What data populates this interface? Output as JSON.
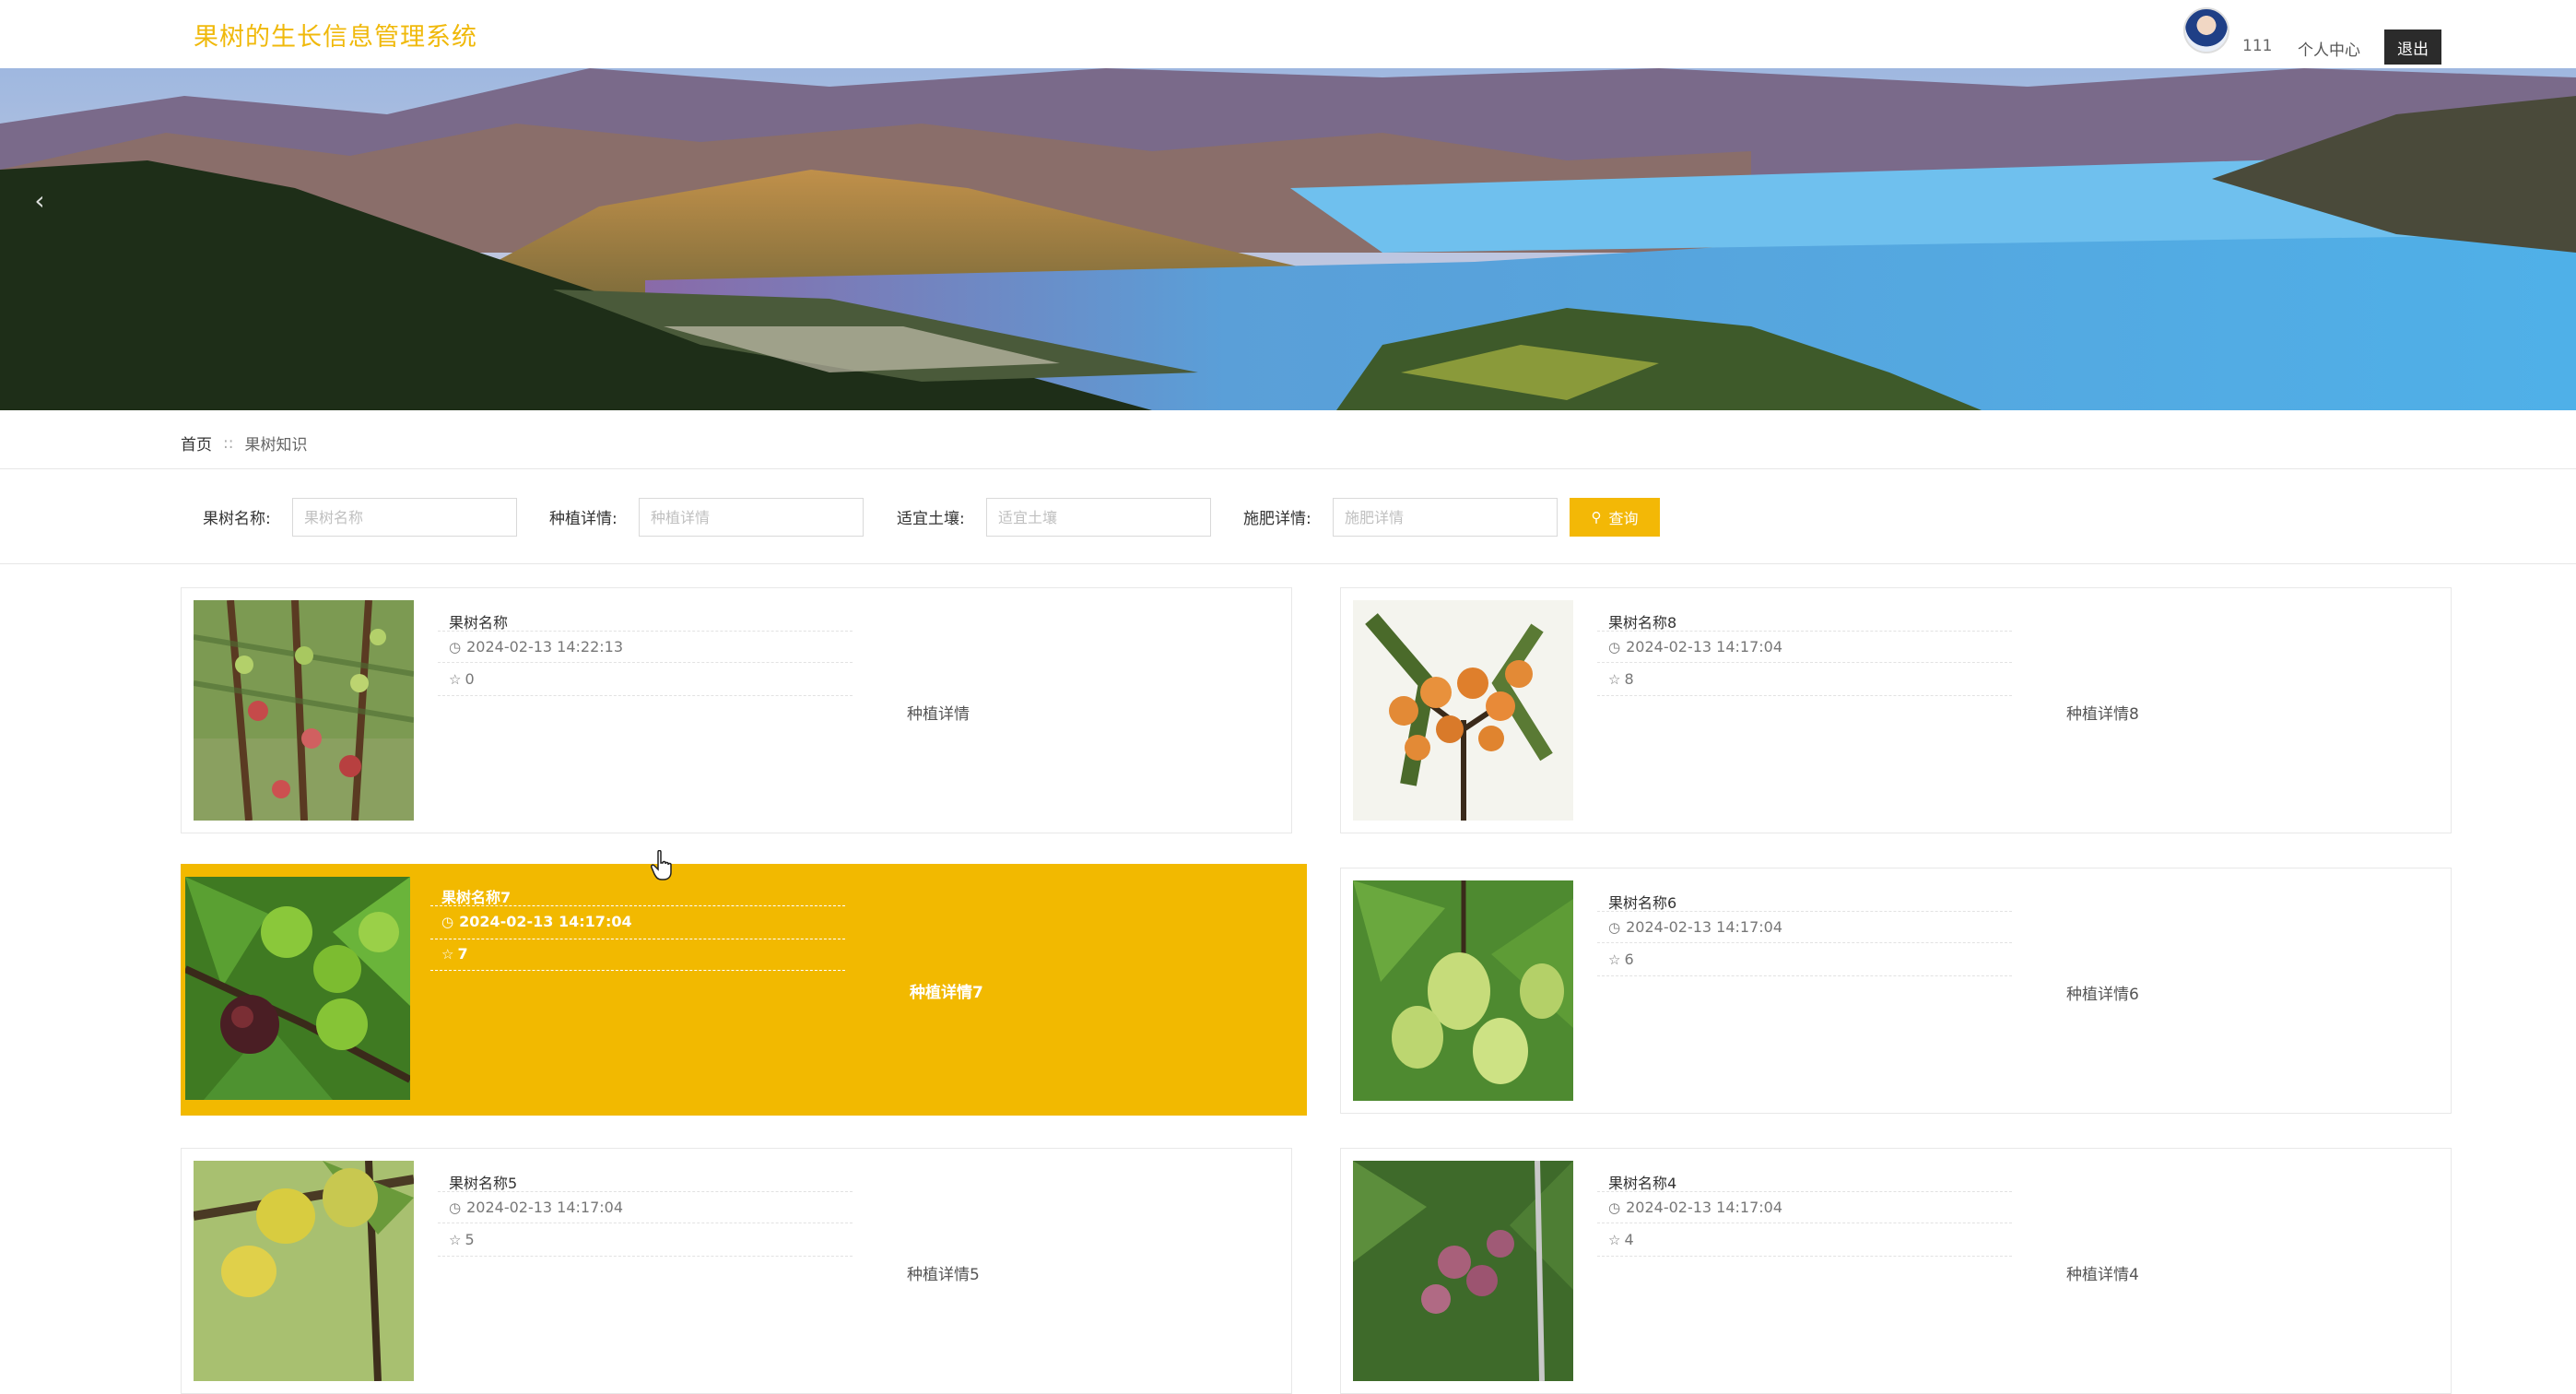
{
  "header": {
    "app_title": "果树的生长信息管理系统",
    "username": "111",
    "center_label": "个人中心",
    "logout_label": "退出"
  },
  "banner": {
    "prev_label": "‹",
    "active_dot": 0
  },
  "breadcrumb": {
    "home": "首页",
    "separator": "::",
    "current": "果树知识"
  },
  "search": {
    "fields": [
      {
        "label": "果树名称:",
        "placeholder": "果树名称",
        "value": ""
      },
      {
        "label": "种植详情:",
        "placeholder": "种植详情",
        "value": ""
      },
      {
        "label": "适宜土壤:",
        "placeholder": "适宜土壤",
        "value": ""
      },
      {
        "label": "施肥详情:",
        "placeholder": "施肥详情",
        "value": ""
      }
    ],
    "button_label": "查询"
  },
  "colors": {
    "accent": "#f2b900",
    "title": "#f0b90b"
  },
  "cards": [
    {
      "title": "果树名称",
      "time": "2024-02-13 14:22:13",
      "stars": "0",
      "detail": "种植详情",
      "fruit": "apple-branch",
      "highlighted": false
    },
    {
      "title": "果树名称8",
      "time": "2024-02-13 14:17:04",
      "stars": "8",
      "detail": "种植详情8",
      "fruit": "loquat",
      "highlighted": false
    },
    {
      "title": "果树名称7",
      "time": "2024-02-13 14:17:04",
      "stars": "7",
      "detail": "种植详情7",
      "fruit": "fig",
      "highlighted": true
    },
    {
      "title": "果树名称6",
      "time": "2024-02-13 14:17:04",
      "stars": "6",
      "detail": "种植详情6",
      "fruit": "pear",
      "highlighted": false
    },
    {
      "title": "果树名称5",
      "time": "2024-02-13 14:17:04",
      "stars": "5",
      "detail": "种植详情5",
      "fruit": "lemon",
      "highlighted": false
    },
    {
      "title": "果树名称4",
      "time": "2024-02-13 14:17:04",
      "stars": "4",
      "detail": "种植详情4",
      "fruit": "plum",
      "highlighted": false
    }
  ]
}
